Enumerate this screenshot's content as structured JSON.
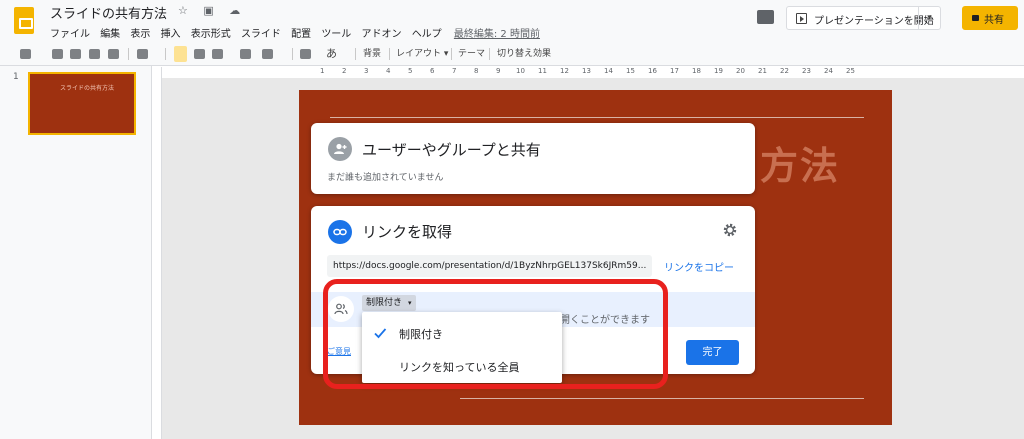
{
  "header": {
    "title": "スライドの共有方法",
    "title_icons": "☆ ▣ ☁",
    "menu": [
      "ファイル",
      "編集",
      "表示",
      "挿入",
      "表示形式",
      "スライド",
      "配置",
      "ツール",
      "アドオン",
      "ヘルプ"
    ],
    "last_edit": "最終編集: 2 時間前",
    "present_label": "プレゼンテーションを開始",
    "present_dropdown": "▾",
    "share_label": "共有"
  },
  "toolbar": {
    "text_style_icon": "あ",
    "background": "背景",
    "layout": "レイアウト ▾",
    "theme": "テーマ",
    "transition": "切り替え効果"
  },
  "ruler": [
    "1",
    "2",
    "3",
    "4",
    "5",
    "6",
    "7",
    "8",
    "9",
    "10",
    "11",
    "12",
    "13",
    "14",
    "15",
    "16",
    "17",
    "18",
    "19",
    "20",
    "21",
    "22",
    "23",
    "24",
    "25"
  ],
  "filmstrip": {
    "slide_number": "1",
    "thumb_title": "スライドの共有方法"
  },
  "slide": {
    "title_fragment": "方法"
  },
  "share_people": {
    "title": "ユーザーやグループと共有",
    "subtitle": "まだ誰も追加されていません"
  },
  "get_link": {
    "title": "リンクを取得",
    "url": "https://docs.google.com/presentation/d/1ByzNhrpGEL137Sk6JRm59...",
    "copy_link": "リンクをコピー",
    "access_selected": "制限付き",
    "access_arrow": "▾",
    "access_description": "開くことができます",
    "feedback": "ご意見",
    "done": "完了"
  },
  "access_menu": {
    "options": [
      "制限付き",
      "リンクを知っている全員"
    ],
    "selected_index": 0
  },
  "colors": {
    "accent": "#1a73e8",
    "slide_background": "#9e3110",
    "share_button": "#f4b400",
    "highlight": "#e8211e"
  }
}
